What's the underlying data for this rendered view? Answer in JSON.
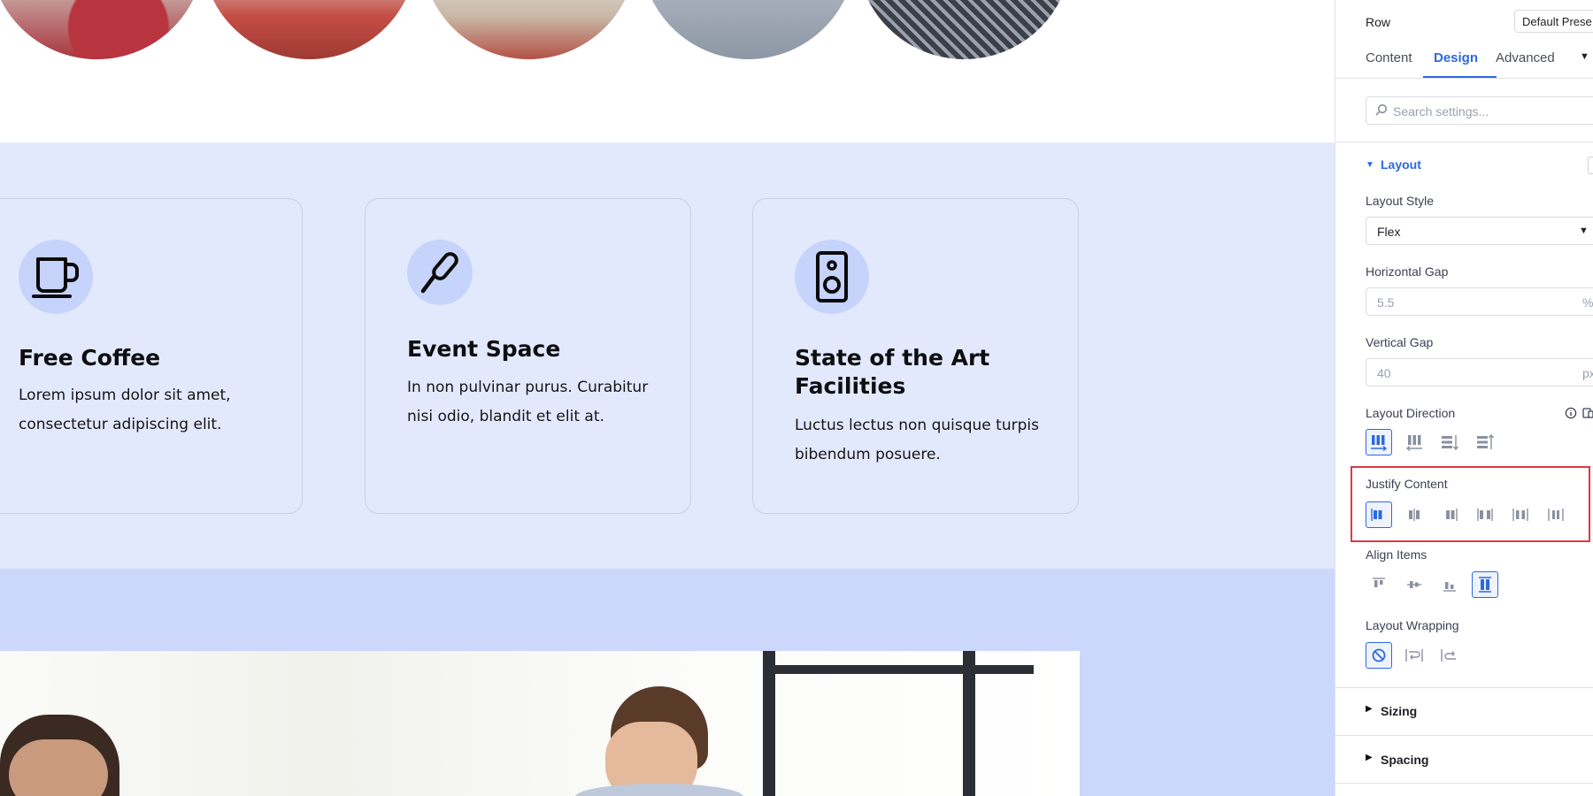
{
  "features": {
    "cards": [
      {
        "title": "Free Coffee",
        "body": "Lorem ipsum dolor sit amet, consectetur adipiscing elit.",
        "icon": "coffee-mug-icon"
      },
      {
        "title": "Event Space",
        "body": "In non pulvinar purus. Curabitur nisi odio, blandit et elit at.",
        "icon": "microphone-icon"
      },
      {
        "title": "State of the Art Facilities",
        "body": "Luctus lectus non quisque turpis bibendum posuere.",
        "icon": "speaker-icon"
      }
    ]
  },
  "panel": {
    "module_name": "Row",
    "preset": "Default Prese",
    "tabs": [
      {
        "label": "Content",
        "active": false
      },
      {
        "label": "Design",
        "active": true
      },
      {
        "label": "Advanced",
        "active": false
      }
    ],
    "search_placeholder": "Search settings...",
    "layout": {
      "title": "Layout",
      "layout_style_label": "Layout Style",
      "layout_style_value": "Flex",
      "horizontal_gap_label": "Horizontal Gap",
      "horizontal_gap_value": "5.5",
      "horizontal_gap_unit": "%",
      "vertical_gap_label": "Vertical Gap",
      "vertical_gap_value": "40",
      "vertical_gap_unit": "px",
      "layout_direction_label": "Layout Direction",
      "justify_content_label": "Justify Content",
      "align_items_label": "Align Items",
      "layout_wrapping_label": "Layout Wrapping"
    },
    "sections": [
      {
        "title": "Sizing"
      },
      {
        "title": "Spacing"
      }
    ],
    "colors": {
      "accent": "#2d68e0",
      "highlight_box": "#e0393e",
      "features_bg": "#e3e9fd",
      "band_bg": "#cbd8fc"
    }
  }
}
